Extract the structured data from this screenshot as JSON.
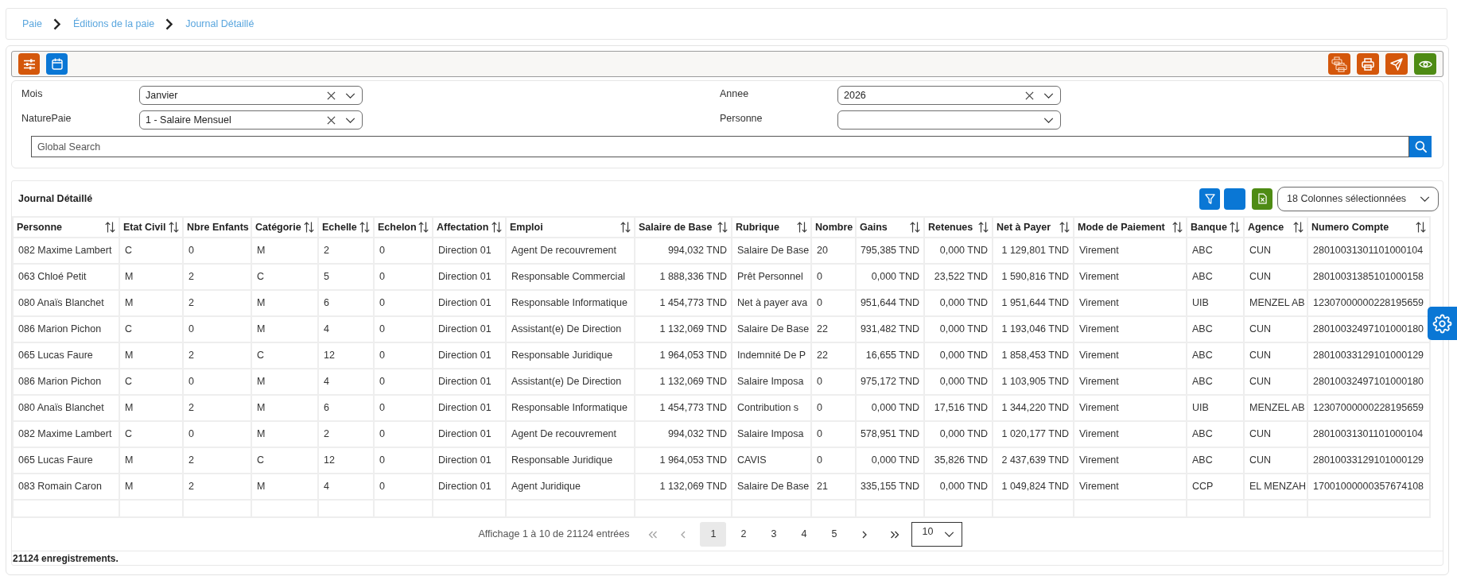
{
  "breadcrumb": [
    "Paie",
    "Éditions de la paie",
    "Journal Détaillé"
  ],
  "filters": [
    {
      "label": "Mois",
      "value": "Janvier"
    },
    {
      "label": "Annee",
      "value": "2026"
    },
    {
      "label": "NaturePaie",
      "value": "1 - Salaire Mensuel"
    },
    {
      "label": "Personne"
    }
  ],
  "global_search": {
    "placeholder": "Global Search"
  },
  "table": {
    "title": "Journal Détaillé",
    "column_selector": "18 Colonnes sélectionnées",
    "columns": [
      {
        "label": "Personne",
        "sortable": true,
        "kind": "text"
      },
      {
        "label": "Etat Civil",
        "sortable": true,
        "kind": "text"
      },
      {
        "label": "Nbre Enfants",
        "sortable": false,
        "kind": "text"
      },
      {
        "label": "Catégorie",
        "sortable": true,
        "kind": "text"
      },
      {
        "label": "Echelle",
        "sortable": true,
        "kind": "text"
      },
      {
        "label": "Echelon",
        "sortable": true,
        "kind": "text"
      },
      {
        "label": "Affectation",
        "sortable": true,
        "kind": "text"
      },
      {
        "label": "Emploi",
        "sortable": true,
        "kind": "text"
      },
      {
        "label": "Salaire de Base",
        "sortable": true,
        "kind": "amount"
      },
      {
        "label": "Rubrique",
        "sortable": true,
        "kind": "text"
      },
      {
        "label": "Nombre",
        "sortable": false,
        "kind": "text"
      },
      {
        "label": "Gains",
        "sortable": true,
        "kind": "amount"
      },
      {
        "label": "Retenues",
        "sortable": true,
        "kind": "amount"
      },
      {
        "label": "Net à Payer",
        "sortable": true,
        "kind": "amount"
      },
      {
        "label": "Mode de Paiement",
        "sortable": true,
        "kind": "text"
      },
      {
        "label": "Banque",
        "sortable": true,
        "kind": "text"
      },
      {
        "label": "Agence",
        "sortable": true,
        "kind": "text"
      },
      {
        "label": "Numero Compte",
        "sortable": true,
        "kind": "text"
      }
    ],
    "rows": [
      [
        "082 Maxime Lambert",
        "C",
        "0",
        "M",
        "2",
        "0",
        "Direction 01",
        "Agent De recouvrement",
        "994,032 TND",
        "Salaire De Base",
        "20",
        "795,385 TND",
        "0,000 TND",
        "1 129,801 TND",
        "Virement",
        "ABC",
        "CUN",
        "28010031301101000104"
      ],
      [
        "063 Chloé Petit",
        "M",
        "2",
        "C",
        "5",
        "0",
        "Direction 01",
        "Responsable Commercial",
        "1 888,336 TND",
        "Prêt Personnel",
        "0",
        "0,000 TND",
        "23,522 TND",
        "1 590,816 TND",
        "Virement",
        "ABC",
        "CUN",
        "28010031385101000158"
      ],
      [
        "080 Anaïs Blanchet",
        "M",
        "2",
        "M",
        "6",
        "0",
        "Direction 01",
        "Responsable Informatique",
        "1 454,773 TND",
        "Net à payer ava",
        "0",
        "951,644 TND",
        "0,000 TND",
        "1 951,644 TND",
        "Virement",
        "UIB",
        "MENZEL AB",
        "12307000000228195659"
      ],
      [
        "086 Marion Pichon",
        "C",
        "0",
        "M",
        "4",
        "0",
        "Direction 01",
        "Assistant(e) De Direction",
        "1 132,069 TND",
        "Salaire De Base",
        "22",
        "931,482 TND",
        "0,000 TND",
        "1 193,046 TND",
        "Virement",
        "ABC",
        "CUN",
        "28010032497101000180"
      ],
      [
        "065 Lucas Faure",
        "M",
        "2",
        "C",
        "12",
        "0",
        "Direction 01",
        "Responsable Juridique",
        "1 964,053 TND",
        "Indemnité De P",
        "22",
        "16,655 TND",
        "0,000 TND",
        "1 858,453 TND",
        "Virement",
        "ABC",
        "CUN",
        "28010033129101000129"
      ],
      [
        "086 Marion Pichon",
        "C",
        "0",
        "M",
        "4",
        "0",
        "Direction 01",
        "Assistant(e) De Direction",
        "1 132,069 TND",
        "Salaire Imposa",
        "0",
        "975,172 TND",
        "0,000 TND",
        "1 103,905 TND",
        "Virement",
        "ABC",
        "CUN",
        "28010032497101000180"
      ],
      [
        "080 Anaïs Blanchet",
        "M",
        "2",
        "M",
        "6",
        "0",
        "Direction 01",
        "Responsable Informatique",
        "1 454,773 TND",
        "Contribution s",
        "0",
        "0,000 TND",
        "17,516 TND",
        "1 344,220 TND",
        "Virement",
        "UIB",
        "MENZEL AB",
        "12307000000228195659"
      ],
      [
        "082 Maxime Lambert",
        "C",
        "0",
        "M",
        "2",
        "0",
        "Direction 01",
        "Agent De recouvrement",
        "994,032 TND",
        "Salaire Imposa",
        "0",
        "578,951 TND",
        "0,000 TND",
        "1 020,177 TND",
        "Virement",
        "ABC",
        "CUN",
        "28010031301101000104"
      ],
      [
        "065 Lucas Faure",
        "M",
        "2",
        "C",
        "12",
        "0",
        "Direction 01",
        "Responsable Juridique",
        "1 964,053 TND",
        "CAVIS",
        "0",
        "0,000 TND",
        "35,826 TND",
        "2 437,639 TND",
        "Virement",
        "ABC",
        "CUN",
        "28010033129101000129"
      ],
      [
        "083 Romain Caron",
        "M",
        "2",
        "M",
        "4",
        "0",
        "Direction 01",
        "Agent Juridique",
        "1 132,069 TND",
        "Salaire De Base",
        "21",
        "335,155 TND",
        "0,000 TND",
        "1 049,824 TND",
        "Virement",
        "CCP",
        "EL MENZAH",
        "17001000000357674108"
      ]
    ]
  },
  "pagination": {
    "summary": "Affichage 1 à 10 de 21124 entrées",
    "first": {
      "disabled": true
    },
    "previous": {
      "disabled": true
    },
    "pages": [
      {
        "label": "1",
        "selected": true
      },
      {
        "label": "2",
        "selected": false
      },
      {
        "label": "3",
        "selected": false
      },
      {
        "label": "4",
        "selected": false
      },
      {
        "label": "5",
        "selected": false
      }
    ],
    "next": {
      "disabled": false
    },
    "last": {
      "disabled": false
    },
    "page_size": "10"
  },
  "record_count": "21124 enregistrements."
}
